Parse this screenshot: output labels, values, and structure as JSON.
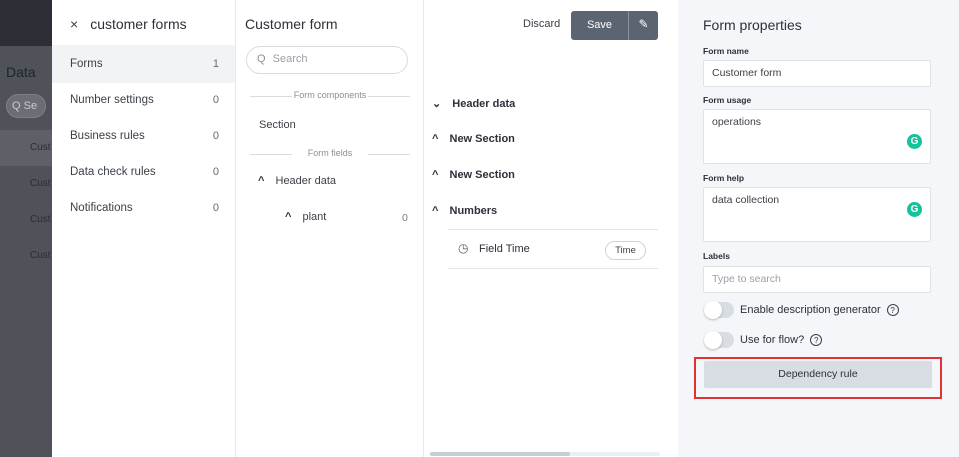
{
  "background": {
    "title": "Data",
    "search_placeholder": "Q Se",
    "rows": [
      "Cust",
      "Cust",
      "Cust",
      "Cust"
    ]
  },
  "forms_panel": {
    "close_icon": "×",
    "title": "customer forms",
    "items": [
      {
        "label": "Forms",
        "count": "1"
      },
      {
        "label": "Number settings",
        "count": "0"
      },
      {
        "label": "Business rules",
        "count": "0"
      },
      {
        "label": "Data check rules",
        "count": "0"
      },
      {
        "label": "Notifications",
        "count": "0"
      }
    ]
  },
  "components_panel": {
    "title": "Customer form",
    "search_placeholder": "Search",
    "components_divider": "Form components",
    "section_item": "Section",
    "fields_divider": "Form fields",
    "header_data": "Header data",
    "plant": "plant",
    "plant_count": "0"
  },
  "toolbar": {
    "discard": "Discard",
    "save": "Save"
  },
  "layout_panel": {
    "sections": [
      {
        "label": "Header data",
        "icon": "chevron-down"
      },
      {
        "label": "New Section",
        "icon": "chevron-up"
      },
      {
        "label": "New Section",
        "icon": "chevron-up"
      },
      {
        "label": "Numbers",
        "icon": "chevron-up"
      }
    ],
    "field": {
      "name": "Field Time",
      "type": "Time"
    }
  },
  "properties": {
    "title": "Form properties",
    "form_name_label": "Form name",
    "form_name_value": "Customer form",
    "form_usage_label": "Form usage",
    "form_usage_value": "operations",
    "form_help_label": "Form help",
    "form_help_value": "data collection",
    "labels_label": "Labels",
    "labels_placeholder": "Type to search",
    "desc_generator": "Enable description generator",
    "use_for_flow": "Use for flow?",
    "dependency_rule": "Dependency rule",
    "grammarly_badge": "G",
    "help_glyph": "?"
  },
  "colors": {
    "primary_button": "#5b6572",
    "highlight_outline": "#e03232",
    "grammarly": "#15c39a"
  }
}
